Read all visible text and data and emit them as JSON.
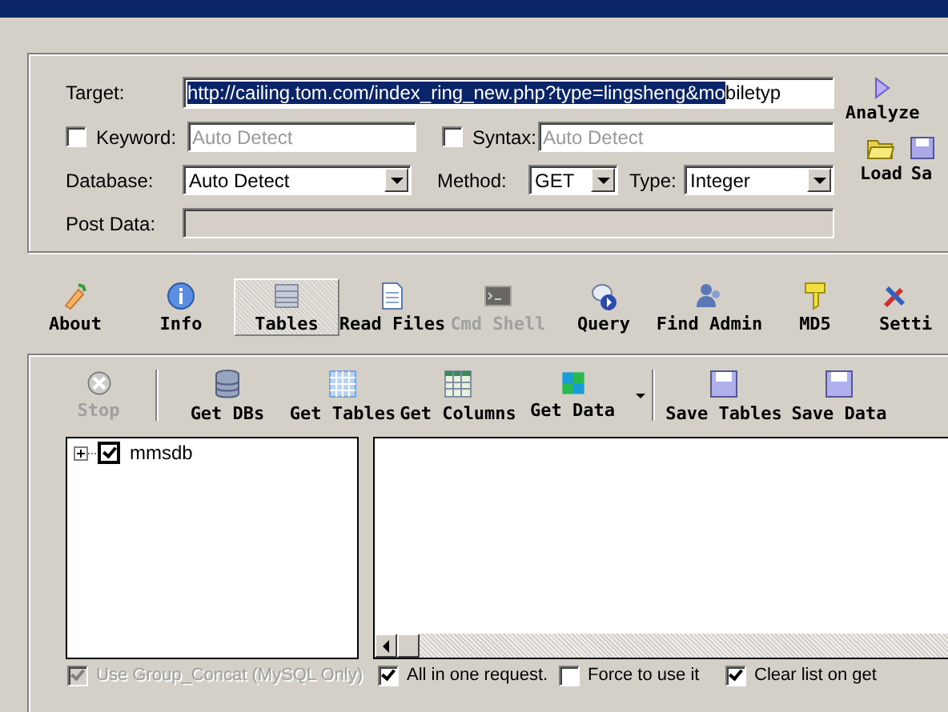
{
  "target": {
    "label": "Target:",
    "selected_text": "http://cailing.tom.com/index_ring_new.php?type=lingsheng&mo",
    "rest_text": "biletyp"
  },
  "keyword": {
    "label": "Keyword:",
    "checked": false,
    "placeholder": "Auto Detect"
  },
  "syntax": {
    "label": "Syntax:",
    "checked": false,
    "placeholder": "Auto Detect"
  },
  "database": {
    "label": "Database:",
    "value": "Auto Detect"
  },
  "method": {
    "label": "Method:",
    "value": "GET"
  },
  "type": {
    "label": "Type:",
    "value": "Integer"
  },
  "post_data": {
    "label": "Post Data:",
    "disabled": true
  },
  "analyze": {
    "label": "Analyze"
  },
  "file_buttons": [
    {
      "label": "Load",
      "kind": "load"
    },
    {
      "label": "Sa",
      "kind": "save"
    }
  ],
  "tabs": [
    {
      "label": "About",
      "kind": "about",
      "selected": false,
      "disabled": false
    },
    {
      "label": "Info",
      "kind": "info",
      "selected": false,
      "disabled": false
    },
    {
      "label": "Tables",
      "kind": "tables",
      "selected": true,
      "disabled": false
    },
    {
      "label": "Read Files",
      "kind": "file",
      "selected": false,
      "disabled": false
    },
    {
      "label": "Cmd Shell",
      "kind": "shell",
      "selected": false,
      "disabled": true
    },
    {
      "label": "Query",
      "kind": "query",
      "selected": false,
      "disabled": false
    },
    {
      "label": "Find Admin",
      "kind": "admin",
      "selected": false,
      "disabled": false
    },
    {
      "label": "MD5",
      "kind": "key",
      "selected": false,
      "disabled": false
    },
    {
      "label": "Setti",
      "kind": "tools",
      "selected": false,
      "disabled": false
    }
  ],
  "actions": [
    {
      "label": "Stop",
      "kind": "stop",
      "disabled": true,
      "separator_after": true,
      "dropdown": false
    },
    {
      "label": "Get DBs",
      "kind": "dbs",
      "disabled": false,
      "separator_after": false,
      "dropdown": false
    },
    {
      "label": "Get Tables",
      "kind": "tables",
      "disabled": false,
      "separator_after": false,
      "dropdown": false
    },
    {
      "label": "Get Columns",
      "kind": "columns",
      "disabled": false,
      "separator_after": false,
      "dropdown": false
    },
    {
      "label": "Get Data",
      "kind": "data",
      "disabled": false,
      "separator_after": true,
      "dropdown": true
    },
    {
      "label": "Save Tables",
      "kind": "save",
      "disabled": false,
      "separator_after": false,
      "dropdown": false
    },
    {
      "label": "Save Data",
      "kind": "save",
      "disabled": false,
      "separator_after": false,
      "dropdown": false
    }
  ],
  "tree": [
    {
      "label": "mmsdb",
      "checked": true,
      "expanded": false
    }
  ],
  "options": [
    {
      "label": "Use Group_Concat (MySQL Only)",
      "checked": true,
      "disabled": true
    },
    {
      "label": "All in one request.",
      "checked": true,
      "disabled": false
    },
    {
      "label": "Force to use it",
      "checked": false,
      "disabled": false
    },
    {
      "label": "Clear list on get",
      "checked": true,
      "disabled": false
    }
  ]
}
